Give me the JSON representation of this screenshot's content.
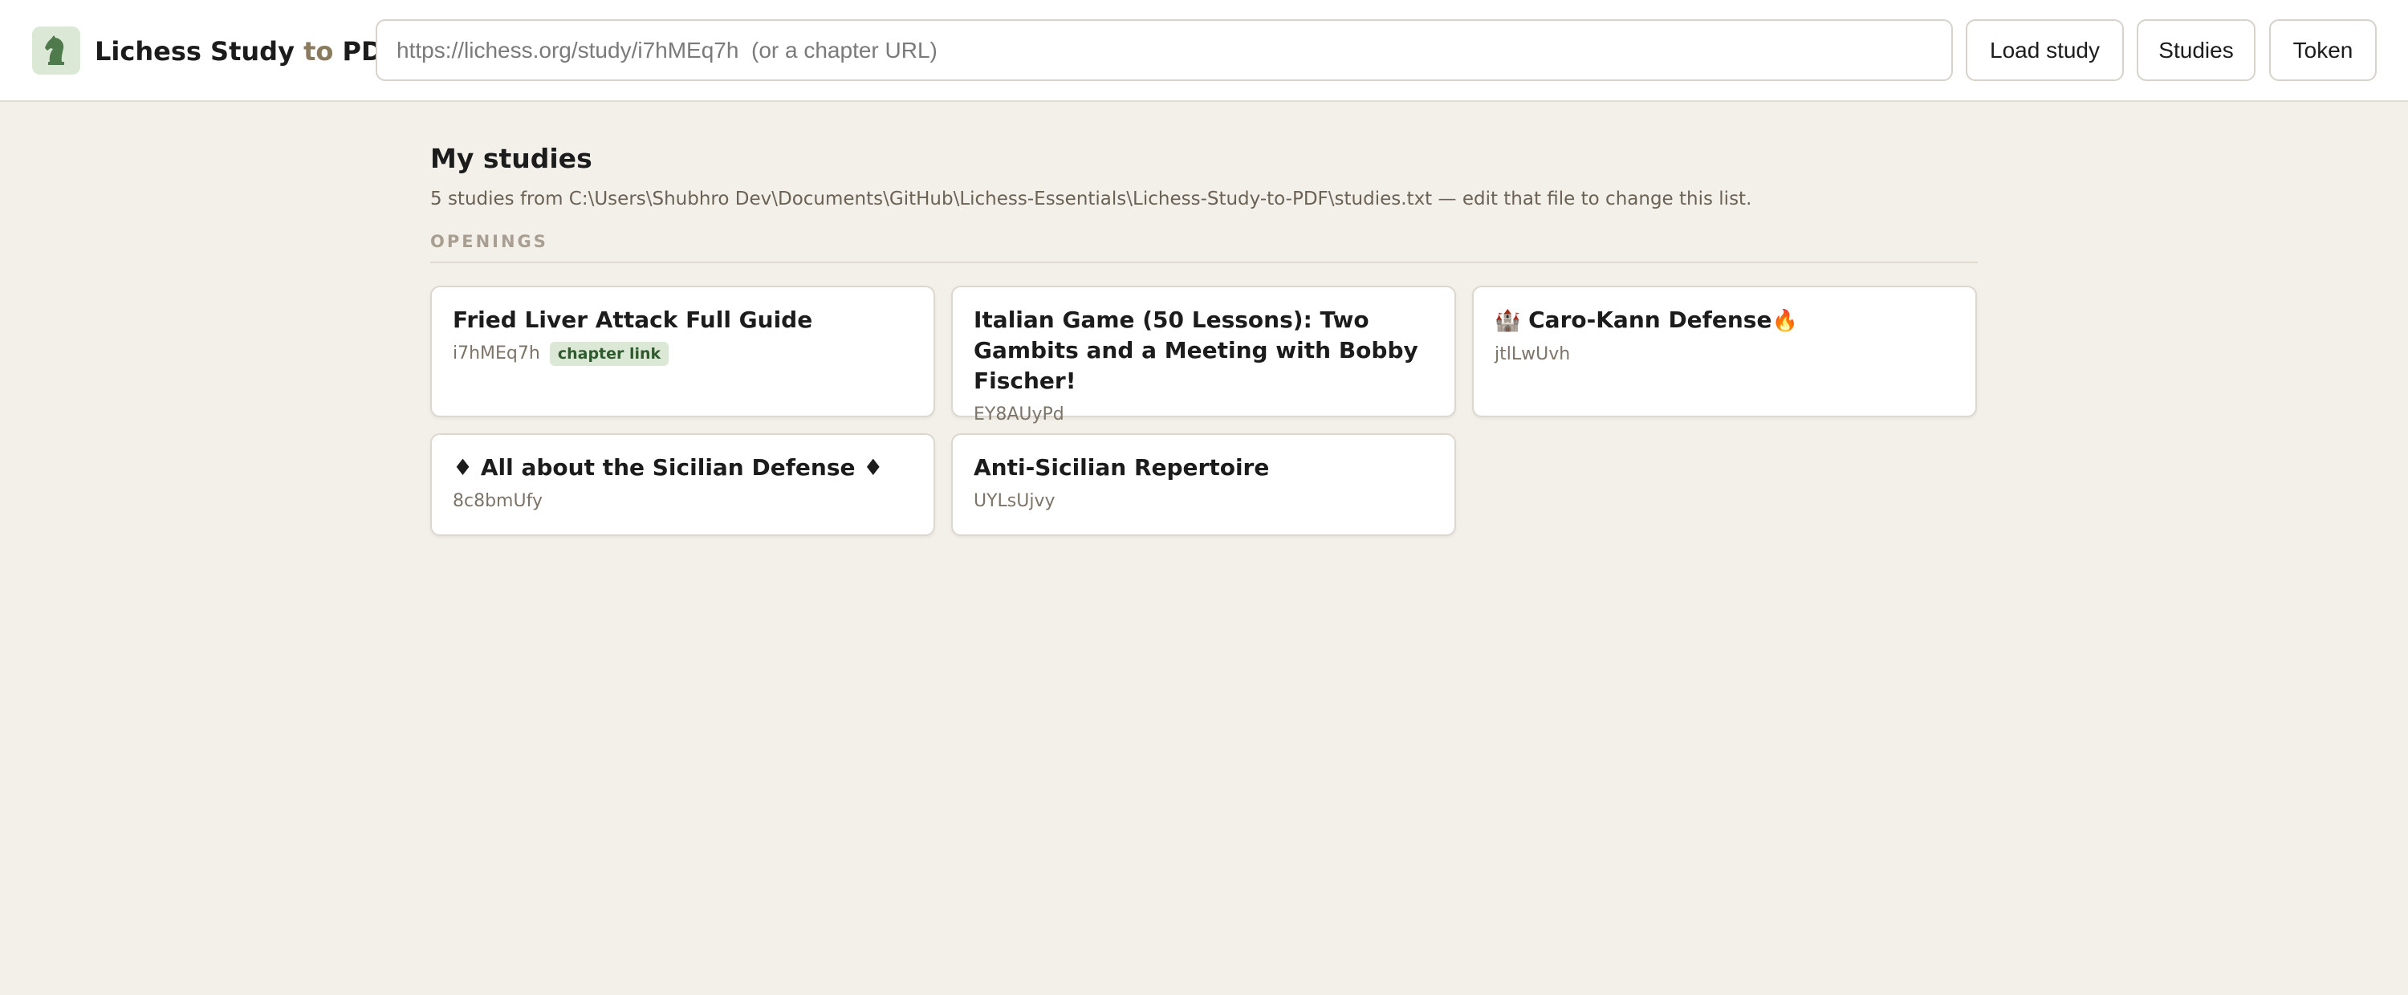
{
  "app": {
    "title_main": "Lichess Study",
    "title_to": "to",
    "title_end": "PDF",
    "logo_icon": "chess-knight-icon",
    "accent": "#dbe8d6",
    "knight_color": "#4f7a4b"
  },
  "toolbar": {
    "url_placeholder": "https://lichess.org/study/i7hMEq7h  (or a chapter URL)",
    "url_value": "",
    "load_label": "Load study",
    "studies_label": "Studies",
    "token_label": "Token"
  },
  "main": {
    "title": "My studies",
    "description": "5 studies from C:\\Users\\Shubhro Dev\\Documents\\GitHub\\Lichess-Essentials\\Lichess-Study-to-PDF\\studies.txt — edit that file to change this list.",
    "section": "OPENINGS",
    "studies": [
      {
        "title": "Fried Liver Attack Full Guide",
        "id": "i7hMEq7h",
        "badge": "chapter link"
      },
      {
        "title": "Italian Game (50 Lessons): Two Gambits and a Meeting with Bobby Fischer!",
        "id": "EY8AUyPd"
      },
      {
        "prefix_emoji": "🏰",
        "title": "Caro-Kann Defense",
        "suffix_emoji": "🔥",
        "id": "jtlLwUvh"
      },
      {
        "title": "♦ All about the Sicilian Defense ♦",
        "id": "8c8bmUfy"
      },
      {
        "title": "Anti-Sicilian Repertoire",
        "id": "UYLsUjvy"
      }
    ]
  }
}
